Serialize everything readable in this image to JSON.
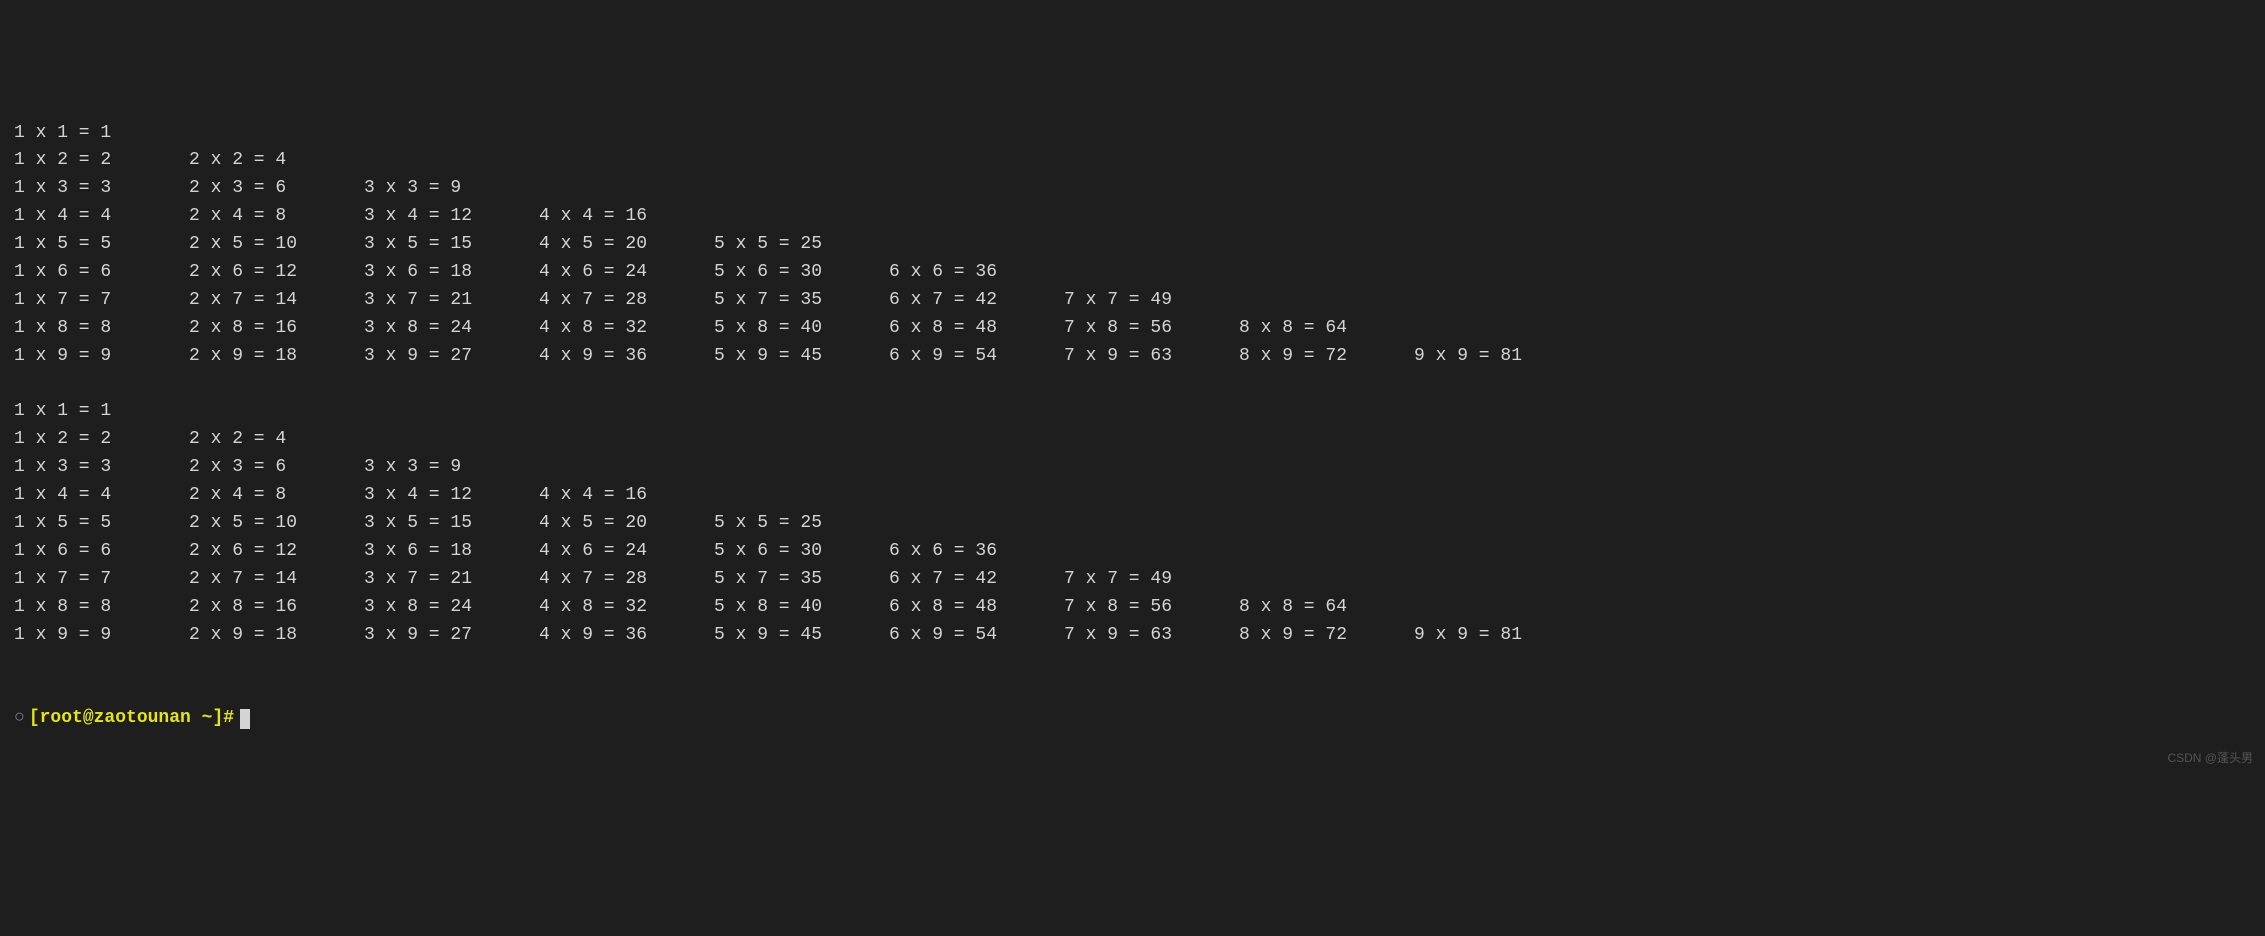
{
  "tables": [
    {
      "rows": [
        [
          "1 x 1 = 1"
        ],
        [
          "1 x 2 = 2",
          "2 x 2 = 4"
        ],
        [
          "1 x 3 = 3",
          "2 x 3 = 6",
          "3 x 3 = 9"
        ],
        [
          "1 x 4 = 4",
          "2 x 4 = 8",
          "3 x 4 = 12",
          "4 x 4 = 16"
        ],
        [
          "1 x 5 = 5",
          "2 x 5 = 10",
          "3 x 5 = 15",
          "4 x 5 = 20",
          "5 x 5 = 25"
        ],
        [
          "1 x 6 = 6",
          "2 x 6 = 12",
          "3 x 6 = 18",
          "4 x 6 = 24",
          "5 x 6 = 30",
          "6 x 6 = 36"
        ],
        [
          "1 x 7 = 7",
          "2 x 7 = 14",
          "3 x 7 = 21",
          "4 x 7 = 28",
          "5 x 7 = 35",
          "6 x 7 = 42",
          "7 x 7 = 49"
        ],
        [
          "1 x 8 = 8",
          "2 x 8 = 16",
          "3 x 8 = 24",
          "4 x 8 = 32",
          "5 x 8 = 40",
          "6 x 8 = 48",
          "7 x 8 = 56",
          "8 x 8 = 64"
        ],
        [
          "1 x 9 = 9",
          "2 x 9 = 18",
          "3 x 9 = 27",
          "4 x 9 = 36",
          "5 x 9 = 45",
          "6 x 9 = 54",
          "7 x 9 = 63",
          "8 x 9 = 72",
          "9 x 9 = 81"
        ]
      ]
    },
    {
      "rows": [
        [
          "1 x 1 = 1"
        ],
        [
          "1 x 2 = 2",
          "2 x 2 = 4"
        ],
        [
          "1 x 3 = 3",
          "2 x 3 = 6",
          "3 x 3 = 9"
        ],
        [
          "1 x 4 = 4",
          "2 x 4 = 8",
          "3 x 4 = 12",
          "4 x 4 = 16"
        ],
        [
          "1 x 5 = 5",
          "2 x 5 = 10",
          "3 x 5 = 15",
          "4 x 5 = 20",
          "5 x 5 = 25"
        ],
        [
          "1 x 6 = 6",
          "2 x 6 = 12",
          "3 x 6 = 18",
          "4 x 6 = 24",
          "5 x 6 = 30",
          "6 x 6 = 36"
        ],
        [
          "1 x 7 = 7",
          "2 x 7 = 14",
          "3 x 7 = 21",
          "4 x 7 = 28",
          "5 x 7 = 35",
          "6 x 7 = 42",
          "7 x 7 = 49"
        ],
        [
          "1 x 8 = 8",
          "2 x 8 = 16",
          "3 x 8 = 24",
          "4 x 8 = 32",
          "5 x 8 = 40",
          "6 x 8 = 48",
          "7 x 8 = 56",
          "8 x 8 = 64"
        ],
        [
          "1 x 9 = 9",
          "2 x 9 = 18",
          "3 x 9 = 27",
          "4 x 9 = 36",
          "5 x 9 = 45",
          "6 x 9 = 54",
          "7 x 9 = 63",
          "8 x 9 = 72",
          "9 x 9 = 81"
        ]
      ]
    }
  ],
  "prompt": {
    "user_host": "[root@zaotounan ",
    "path": "~",
    "end": "]#"
  },
  "watermark": "CSDN @蓬头男"
}
